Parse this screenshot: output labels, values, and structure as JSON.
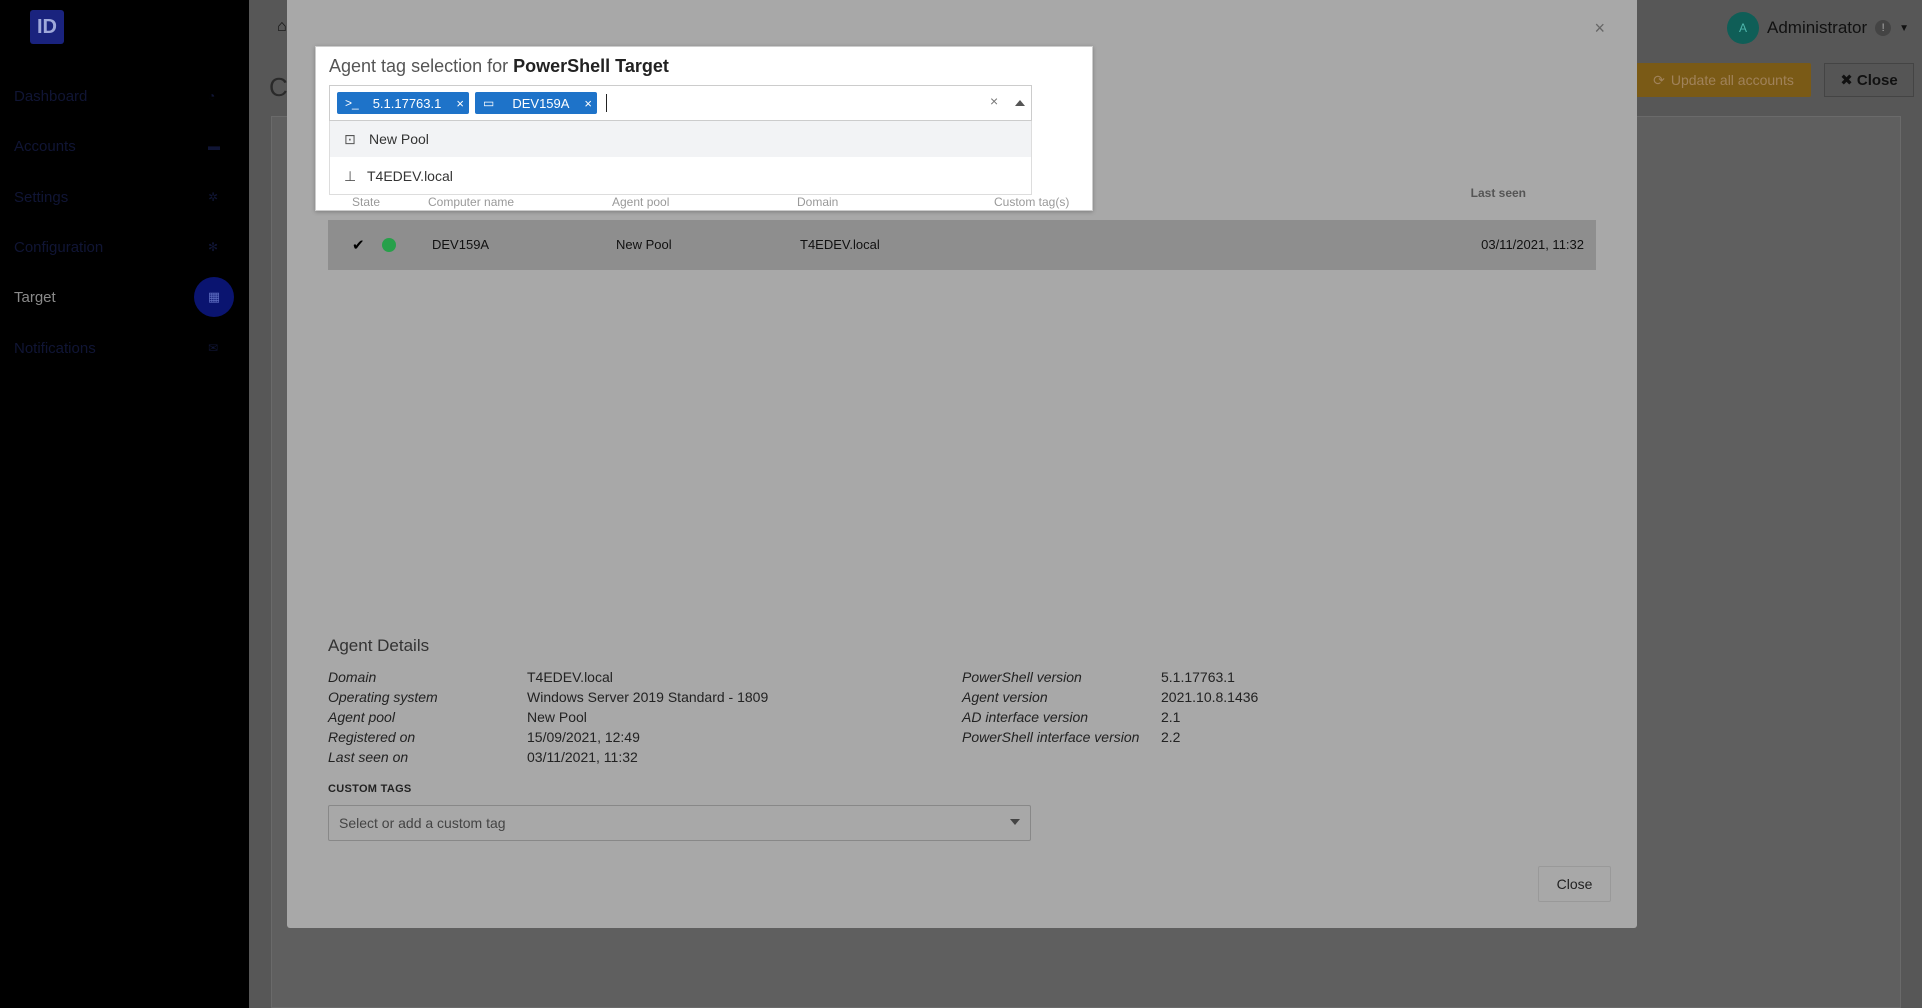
{
  "app": {
    "logo_text": "ID"
  },
  "sidebar": {
    "items": [
      {
        "label": "Dashboard",
        "icon": "chart-icon"
      },
      {
        "label": "Accounts",
        "icon": "users-icon"
      },
      {
        "label": "Settings",
        "icon": "gear-icon"
      },
      {
        "label": "Configuration",
        "icon": "cog-icon"
      },
      {
        "label": "Target",
        "icon": "grid-icon"
      },
      {
        "label": "Notifications",
        "icon": "mail-icon"
      }
    ]
  },
  "header": {
    "user_name": "Administrator",
    "avatar_initial": "A",
    "alert_glyph": "!",
    "update_button": "Update all accounts",
    "close_button": "Close",
    "page_title_fragment": "Cc"
  },
  "popup": {
    "title_prefix": "Agent tag selection for ",
    "title_target": "PowerShell Target",
    "chips": [
      {
        "label": "5.1.17763.1",
        "icon": "powershell-icon"
      },
      {
        "label": "DEV159A",
        "icon": "monitor-icon"
      }
    ],
    "options": [
      {
        "label": "New Pool",
        "icon": "pool-icon"
      },
      {
        "label": "T4EDEV.local",
        "icon": "domain-tree-icon"
      }
    ],
    "hidden_headers": [
      "State",
      "Computer name",
      "Agent pool",
      "Domain",
      "Custom tag(s)"
    ]
  },
  "table": {
    "headers": {
      "last_seen": "Last seen"
    },
    "row": {
      "computer_name": "DEV159A",
      "agent_pool": "New Pool",
      "domain": "T4EDEV.local",
      "last_seen": "03/11/2021, 11:32"
    }
  },
  "details": {
    "title": "Agent Details",
    "left": [
      {
        "label": "Domain",
        "value": "T4EDEV.local"
      },
      {
        "label": "Operating system",
        "value": "Windows Server 2019 Standard - 1809"
      },
      {
        "label": "Agent pool",
        "value": "New Pool"
      },
      {
        "label": "Registered on",
        "value": "15/09/2021, 12:49"
      },
      {
        "label": "Last seen on",
        "value": "03/11/2021, 11:32"
      }
    ],
    "right": [
      {
        "label": "PowerShell version",
        "value": "5.1.17763.1"
      },
      {
        "label": "Agent version",
        "value": "2021.10.8.1436"
      },
      {
        "label": "AD interface version",
        "value": "2.1"
      },
      {
        "label": "PowerShell interface version",
        "value": "2.2"
      }
    ],
    "custom_tags_label": "CUSTOM TAGS",
    "custom_tags_placeholder": "Select or add a custom tag"
  },
  "modal": {
    "close_button": "Close",
    "close_x": "×"
  }
}
